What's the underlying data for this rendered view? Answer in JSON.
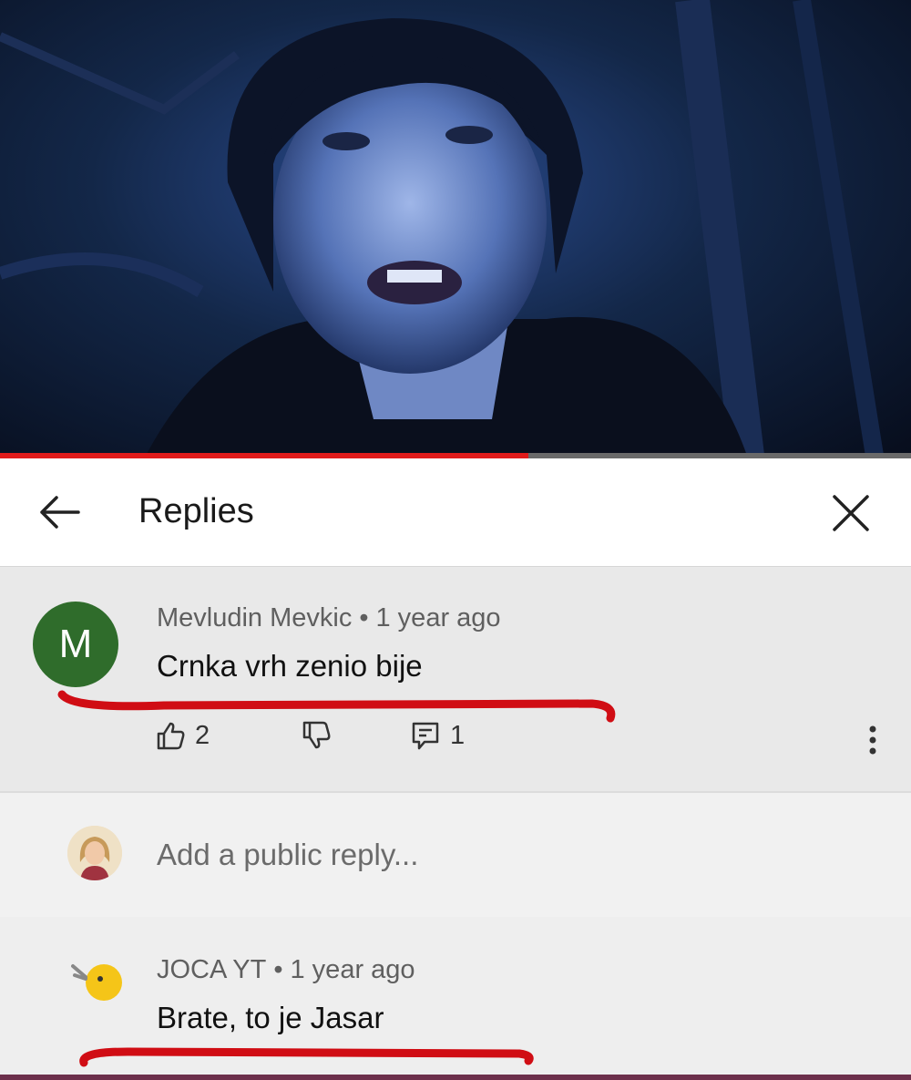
{
  "video": {
    "progress_fraction": 0.58,
    "accent_color": "#e11b1b"
  },
  "header": {
    "title": "Replies",
    "back_icon": "arrow-left-icon",
    "close_icon": "close-icon"
  },
  "comment": {
    "avatar_letter": "M",
    "avatar_color": "#2f6c2b",
    "author": "Mevludin Mevkic",
    "separator": "•",
    "time": "1 year ago",
    "text": "Crnka vrh zenio bije",
    "likes": "2",
    "replies": "1",
    "icons": [
      "thumbs-up-icon",
      "thumbs-down-icon",
      "reply-icon",
      "more-vert-icon"
    ]
  },
  "reply_box": {
    "placeholder": "Add a public reply..."
  },
  "reply": {
    "author": "JOCA YT",
    "separator": "•",
    "time": "1 year ago",
    "text": "Brate, to je Jasar"
  },
  "annotation_color": "#d00d14"
}
